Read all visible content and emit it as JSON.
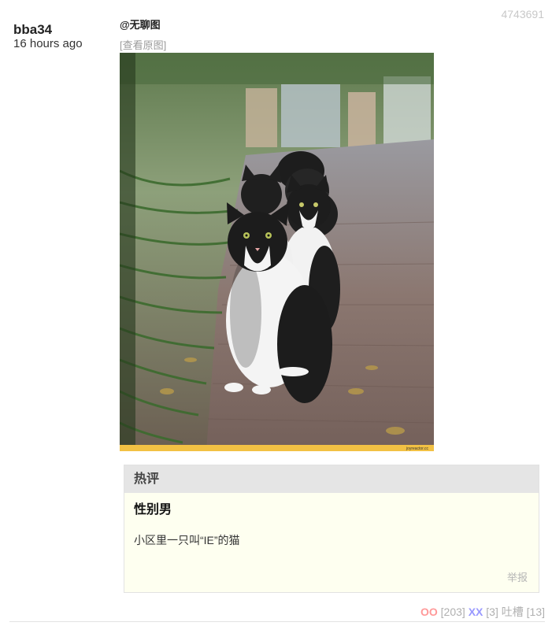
{
  "post": {
    "id": "4743691",
    "author": "bba34",
    "time": "16 hours ago",
    "mention": "@无聊图",
    "view_original": "[查看原图]",
    "image_alt": "Row of black and white cats on brick path",
    "watermark": "joyreactor.cc"
  },
  "hot_comment": {
    "header": "热评",
    "user": "性别男",
    "text": "小区里一只叫“IE”的猫",
    "report": "举报"
  },
  "votes": {
    "oo_label": "OO",
    "oo_count": "[203]",
    "xx_label": "XX",
    "xx_count": "[3]",
    "tucao_label": "吐槽",
    "tucao_count": "[13]"
  },
  "colors": {
    "oo": "#ff9999",
    "xx": "#9999ff",
    "hot_bg": "#fefff0",
    "hot_header_bg": "#e5e5e5",
    "muted": "#b0b0b0"
  }
}
